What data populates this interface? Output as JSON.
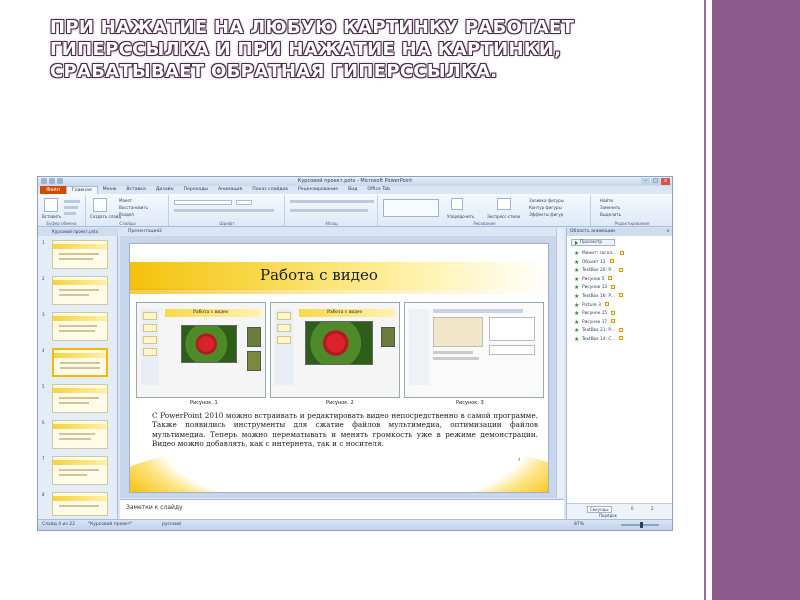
{
  "title": "При нажатие на любую картинку работает гиперссылка и при нажатие на картинки, срабатывает обратная гиперссылка.",
  "window": {
    "title": "Курсовой проект.potx - Microsoft PowerPoint",
    "controls": [
      "–",
      "□",
      "x"
    ]
  },
  "ribbon": {
    "file_tab": "Файл",
    "tabs": [
      "Главная",
      "Меню",
      "Вставка",
      "Дизайн",
      "Переходы",
      "Анимация",
      "Показ слайдов",
      "Рецензирование",
      "Вид",
      "Office Tab"
    ],
    "groups": [
      "Буфер обмена",
      "Слайды",
      "Шрифт",
      "Абзац",
      "Рисование",
      "Редактирование"
    ],
    "buttons": {
      "paste": "Вставить",
      "new_slide": "Создать слайд",
      "layout": "Макет",
      "reset": "Восстановить",
      "section": "Раздел",
      "arrange": "Упорядочить",
      "quick_styles": "Экспресс-стили",
      "shape_fill": "Заливка фигуры",
      "shape_outline": "Контур фигуры",
      "shape_effects": "Эффекты фигур",
      "find": "Найти",
      "replace": "Заменить",
      "select": "Выделить"
    }
  },
  "doc_tabs": [
    "Курсовой проект.potx",
    "Презентация2"
  ],
  "slide": {
    "title": "Работа с видео",
    "captions": [
      "Рисунок. 1",
      "Рисунок. 2",
      "Рисунок. 3"
    ],
    "shot_title": "Работа с видео",
    "body": "С PowerPoint 2010 можно встраивать и редактировать видео непосредственно в самой программе. Также появились инструменты для сжатие файлов мультимедиа, оптимизации файлов мультимедиа. Теперь можно перематывать и менять громкость уже в режиме демонстрации. Видео можно добавлять, как с интернета, так и с носителя.",
    "number": "4"
  },
  "thumbnails": [
    "1",
    "2",
    "3",
    "4",
    "5",
    "6",
    "7",
    "8"
  ],
  "notes_placeholder": "Заметки к слайду",
  "animation_pane": {
    "title": "Область анимации",
    "preview_button": "Просмотр",
    "items": [
      "Минит: загол...",
      "Объект 12",
      "TextBox 20: Р...",
      "Рисунок 5",
      "Рисунок 13",
      "TextBox 16: Р...",
      "Picture 3",
      "Рисунок 15",
      "Рисунок 17",
      "TextBox 21: Р...",
      "TextBox 14: С..."
    ],
    "seconds_label": "Секунды",
    "timeline_start": "0",
    "timeline_end": "2",
    "order_label": "Порядок"
  },
  "status": {
    "slide_info": "Слайд 4 из 22",
    "theme": "\"Курсовой проект\"",
    "language": "русский",
    "zoom": "87%"
  }
}
